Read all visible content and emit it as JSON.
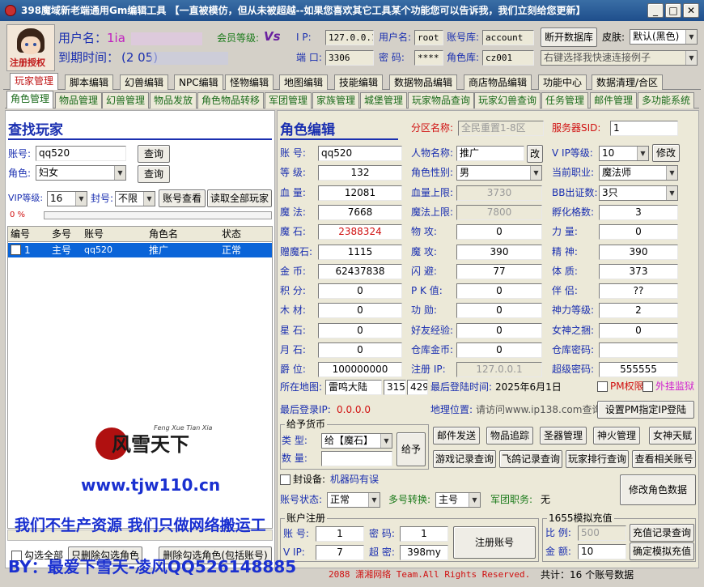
{
  "window": {
    "title": "398魔域新老端通用Gm编辑工具 【一直被模仿，但从未被超越--如果您喜欢其它工具某个功能您可以告诉我，我们立刻给您更新】",
    "min": "0",
    "max": "1",
    "close": "r"
  },
  "account": {
    "user_label": "用户名：",
    "user_value": "1ia",
    "member_label": "会员等级:",
    "member_badge": "Vs",
    "expire_label": "到期时间：",
    "expire_value": "(2                  05)",
    "avatar_caption": "注册授权"
  },
  "db": {
    "ip_label": "I  P:",
    "ip": "127.0.0.1",
    "user_label": "用户名:",
    "user": "root",
    "acctdb_label": "账号库:",
    "acctdb": "account",
    "disconnect": "断开数据库",
    "skin_label": "皮肤:",
    "skin": "默认(黑色)",
    "port_label": "端 口:",
    "port": "3306",
    "pwd_label": "密  码:",
    "pwd": "****",
    "roledb_label": "角色库:",
    "roledb": "cz001",
    "quick": "右键选择我快速连接例子"
  },
  "main_tabs": [
    "玩家管理",
    "脚本编辑",
    "幻兽编辑",
    "NPC编辑",
    "怪物编辑",
    "地图编辑",
    "技能编辑",
    "数据物品编辑",
    "商店物品编辑",
    "功能中心",
    "数据清理/合区"
  ],
  "sub_tabs": [
    "角色管理",
    "物品管理",
    "幻兽管理",
    "物品发放",
    "角色物品转移",
    "军团管理",
    "家族管理",
    "城堡管理",
    "玩家物品查询",
    "玩家幻兽查询",
    "任务管理",
    "邮件管理",
    "多功能系统"
  ],
  "find": {
    "title": "查找玩家",
    "acct_label": "账号:",
    "acct_value": "qq520",
    "query": "查询",
    "role_label": "角色:",
    "role_value": "妇女",
    "query2": "查询",
    "vip_label": "VIP等级:",
    "vip_value": "16",
    "ban_label": "封号:",
    "ban_value": "不限",
    "acct_view": "账号查看",
    "read_all": "读取全部玩家",
    "progress": "0 %",
    "cols": [
      "编号",
      "多号",
      "账号",
      "角色名",
      "状态"
    ],
    "rows": [
      [
        "1",
        "主号",
        "qq520",
        "推广",
        "正常"
      ]
    ]
  },
  "watermark": {
    "site": "www.tjw110.cn",
    "slogan": "我们不生产资源 我们只做网络搬运工",
    "author": "BY：最爱下雪天-凌风QQ526148885",
    "logo": "风雪天下",
    "logo_sub": "Feng Xue Tian Xia"
  },
  "left_bottom": {
    "check_all": "勾选全部",
    "del_role": "只删除勾选角色",
    "del_role_acct": "删除勾选角色(包括账号)"
  },
  "edit": {
    "title": "角色编辑",
    "zone_label": "分区名称:",
    "zone": "全民重置1-8区",
    "server_label": "服务器SID:",
    "server": "1",
    "acct_label": "账  号:",
    "acct": "qq520",
    "name_label": "人物名称:",
    "name": "推广",
    "rename": "改",
    "vip_label": "V IP等级:",
    "vip": "10",
    "modify": "修改",
    "level_label": "等  级:",
    "level": "132",
    "sex_label": "角色性别:",
    "sex": "男",
    "job_label": "当前职业:",
    "job": "魔法师",
    "hp_label": "血  量:",
    "hp": "12081",
    "hpmax_label": "血量上限:",
    "hpmax": "3730",
    "bb_label": "BB出证数:",
    "bb": "3只",
    "mp_label": "魔  法:",
    "mp": "7668",
    "mpmax_label": "魔法上限:",
    "mpmax": "7800",
    "hatch_label": "孵化格数:",
    "hatch": "3",
    "ms_label": "魔  石:",
    "ms": "2388324",
    "patk_label": "物  攻:",
    "patk": "0",
    "str_label": "力  量:",
    "str": "0",
    "gms_label": "赠魔石:",
    "gms": "1115",
    "matk_label": "魔  攻:",
    "matk": "390",
    "spi_label": "精  神:",
    "spi": "390",
    "gold_label": "金  币:",
    "gold": "62437838",
    "dodge_label": "闪  避:",
    "dodge": "77",
    "con_label": "体  质:",
    "con": "373",
    "pts_label": "积  分:",
    "pts": "0",
    "pk_label": "P K 值:",
    "pk": "0",
    "mate_label": "伴  侣:",
    "mate": "??",
    "wood_label": "木  材:",
    "wood": "0",
    "merit_label": "功  勋:",
    "merit": "0",
    "god_label": "神力等级:",
    "god": "2",
    "star_label": "星  石:",
    "star": "0",
    "friend_label": "好友经验:",
    "friend": "0",
    "goddess_label": "女神之捆:",
    "goddess": "0",
    "moon_label": "月  石:",
    "moon": "0",
    "wh_gold_label": "仓库金币:",
    "wh_gold": "0",
    "wh_pwd_label": "仓库密码:",
    "wh_pwd": "",
    "title_label": "爵  位:",
    "titlev": "100000000",
    "regip_label": "注册  IP:",
    "regip": "127.0.0.1",
    "superpwd_label": "超级密码:",
    "superpwd": "555555",
    "map_label": "所在地图:",
    "map": "雷鸣大陆",
    "mx": "315",
    "my": "429",
    "lastlogin_label": "最后登陆时间:",
    "lastlogin": "2025年6月1日",
    "pm": "PM权限",
    "plugin": "外挂监狱",
    "lastip_label": "最后登录IP:",
    "lastip": "0.0.0.0",
    "loc_label": "地理位置:",
    "loc": "请访问www.ip138.com查询",
    "setpm": "设置PM指定IP登陆"
  },
  "give": {
    "title": "给予货币",
    "type_label": "类  型:",
    "type": "给【魔石】",
    "qty_label": "数  量:",
    "qty": "",
    "btn": "给予"
  },
  "actions": [
    "邮件发送",
    "物品追踪",
    "圣器管理",
    "神火管理",
    "女神天赋",
    "游戏记录查询",
    "飞鸽记录查询",
    "玩家排行查询",
    "查看相关账号"
  ],
  "ban": {
    "label": "封设备:",
    "value": "机器码有误"
  },
  "status": {
    "acct_label": "账号状态:",
    "acct": "正常",
    "multi_label": "多号转换:",
    "multi": "主号",
    "army_label": "军团职务:",
    "army": "无",
    "modify": "修改角色数据"
  },
  "reg": {
    "title": "账户注册",
    "acct_label": "账  号:",
    "acct": "1",
    "pwd_label": "密  码:",
    "pwd": "1",
    "vip_label": "V IP:",
    "vip": "7",
    "super_label": "超  密:",
    "super": "398my",
    "btn": "注册账号"
  },
  "recharge": {
    "title": "1655模拟充值",
    "ratio_label": "比  例:",
    "ratio": "500",
    "query": "充值记录查询",
    "amount_label": "金  额:",
    "amount": "10",
    "confirm": "确定模拟充值"
  },
  "footer": {
    "copy": "2088  潇湘网络 Team.All Rights Reserved.",
    "count": "共计：16 个账号数据"
  }
}
